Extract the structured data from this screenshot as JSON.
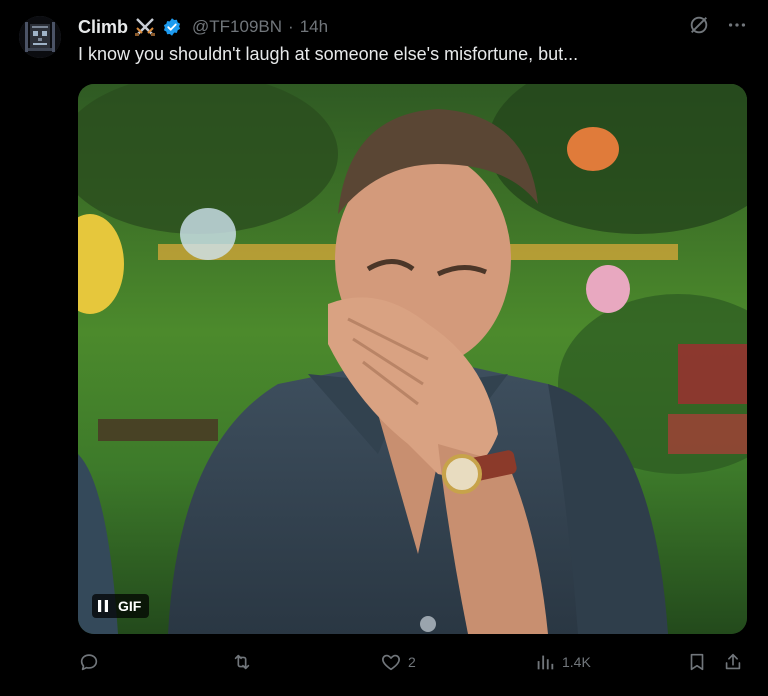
{
  "tweet": {
    "author_name": "Climb",
    "handle": "@TF109BN",
    "separator": "·",
    "time": "14h",
    "text": "I know you shouldn't laugh at someone else's misfortune, but...",
    "media": {
      "badge_label": "GIF"
    },
    "actions": {
      "reply_count": "",
      "retweet_count": "",
      "like_count": "2",
      "views_count": "1.4K"
    }
  },
  "icons": {
    "avatar": "pixel-skull-avatar",
    "name_badge": "crossed-swords-icon",
    "verified": "verified-badge-icon",
    "grok": "grok-icon",
    "more": "more-icon",
    "pause": "pause-icon",
    "reply": "reply-icon",
    "retweet": "retweet-icon",
    "like": "heart-icon",
    "views": "views-icon",
    "bookmark": "bookmark-icon",
    "share": "share-icon"
  },
  "colors": {
    "background": "#000000",
    "text_primary": "#e7e9ea",
    "text_secondary": "#71767b",
    "verified": "#1d9bf0"
  }
}
